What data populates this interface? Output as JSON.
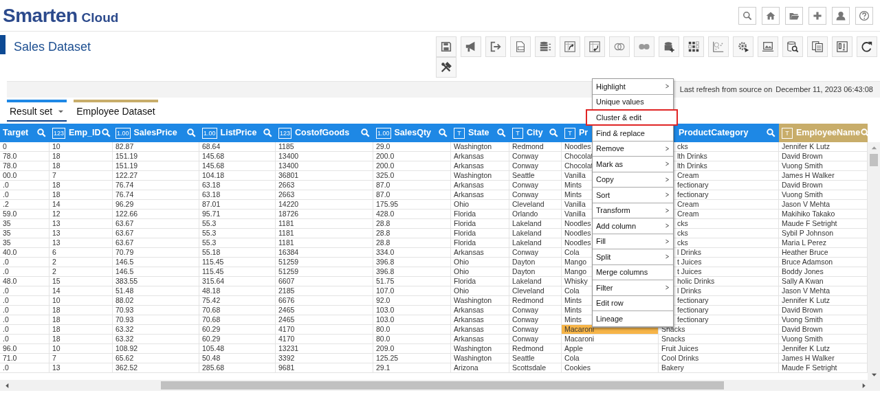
{
  "app": {
    "brand": "Smarten",
    "product": "Cloud"
  },
  "page_title": "Sales Dataset",
  "refresh": {
    "label": "Last refresh from source on",
    "timestamp": "December 11, 2023 06:43:08"
  },
  "tabs": [
    {
      "label": "Result set",
      "selected": true,
      "dropdown": true,
      "color": "#1e88e5"
    },
    {
      "label": "Employee Dataset",
      "selected": false,
      "dropdown": false,
      "color": "#c8ad6a"
    }
  ],
  "table": {
    "columns": [
      {
        "name": "Target",
        "searchable": true,
        "color": "#1e88e5"
      },
      {
        "name": "Emp_ID",
        "type_icon": "123",
        "searchable": true,
        "color": "#1e88e5"
      },
      {
        "name": "SalesPrice",
        "type_icon": "1.00",
        "searchable": true,
        "color": "#1e88e5"
      },
      {
        "name": "ListPrice",
        "type_icon": "1.00",
        "searchable": true,
        "color": "#1e88e5"
      },
      {
        "name": "CostofGoods",
        "type_icon": "123",
        "searchable": true,
        "color": "#1e88e5"
      },
      {
        "name": "SalesQty",
        "type_icon": "1.00",
        "searchable": true,
        "color": "#1e88e5"
      },
      {
        "name": "State",
        "type_icon": "T",
        "searchable": true,
        "color": "#1e88e5"
      },
      {
        "name": "City",
        "type_icon": "T",
        "searchable": true,
        "color": "#1e88e5"
      },
      {
        "name": "Pr",
        "type_icon": "T",
        "color": "#1e88e5"
      },
      {
        "name": "ProductCategory",
        "searchable": true,
        "color": "#1e88e5"
      },
      {
        "name": "EmployeeName",
        "type_icon": "T",
        "searchable": true,
        "color": "#c8ad6a"
      }
    ],
    "rows": [
      {
        "cells": [
          "0",
          "10",
          "82.87",
          "68.64",
          "1185",
          "29.0",
          "Washington",
          "Redmond",
          "Noodles",
          "cks",
          "Jennifer K Lutz"
        ],
        "highlighted": false
      },
      {
        "cells": [
          "78.0",
          "18",
          "151.19",
          "145.68",
          "13400",
          "200.0",
          "Arkansas",
          "Conway",
          "Chocolat",
          "lth Drinks",
          "David Brown"
        ],
        "highlighted": false
      },
      {
        "cells": [
          "78.0",
          "18",
          "151.19",
          "145.68",
          "13400",
          "200.0",
          "Arkansas",
          "Conway",
          "Chocolat",
          "lth Drinks",
          "Vuong Smith"
        ],
        "highlighted": false
      },
      {
        "cells": [
          "00.0",
          "7",
          "122.27",
          "104.18",
          "36801",
          "325.0",
          "Washington",
          "Seattle",
          "Vanilla",
          "Cream",
          "James H Walker"
        ],
        "highlighted": false
      },
      {
        "cells": [
          ".0",
          "18",
          "76.74",
          "63.18",
          "2663",
          "87.0",
          "Arkansas",
          "Conway",
          "Mints",
          "fectionary",
          "David Brown"
        ],
        "highlighted": false
      },
      {
        "cells": [
          ".0",
          "18",
          "76.74",
          "63.18",
          "2663",
          "87.0",
          "Arkansas",
          "Conway",
          "Mints",
          "fectionary",
          "Vuong Smith"
        ],
        "highlighted": false
      },
      {
        "cells": [
          ".2",
          "14",
          "96.29",
          "87.01",
          "14220",
          "175.95",
          "Ohio",
          "Cleveland",
          "Vanilla",
          "Cream",
          "Jason V Mehta"
        ],
        "highlighted": false
      },
      {
        "cells": [
          "59.0",
          "12",
          "122.66",
          "95.71",
          "18726",
          "428.0",
          "Florida",
          "Orlando",
          "Vanilla",
          "Cream",
          "Makihiko Takako"
        ],
        "highlighted": false
      },
      {
        "cells": [
          "35",
          "13",
          "63.67",
          "55.3",
          "1181",
          "28.8",
          "Florida",
          "Lakeland",
          "Noodles",
          "cks",
          "Maude F Setright"
        ],
        "highlighted": false
      },
      {
        "cells": [
          "35",
          "13",
          "63.67",
          "55.3",
          "1181",
          "28.8",
          "Florida",
          "Lakeland",
          "Noodles",
          "cks",
          "Sybil P Johnson"
        ],
        "highlighted": false
      },
      {
        "cells": [
          "35",
          "13",
          "63.67",
          "55.3",
          "1181",
          "28.8",
          "Florida",
          "Lakeland",
          "Noodles",
          "cks",
          "Maria L Perez"
        ],
        "highlighted": false
      },
      {
        "cells": [
          "40.0",
          "6",
          "70.79",
          "55.18",
          "16384",
          "334.0",
          "Arkansas",
          "Conway",
          "Cola",
          "l Drinks",
          "Heather Bruce"
        ],
        "highlighted": false
      },
      {
        "cells": [
          ".0",
          "2",
          "146.5",
          "115.45",
          "51259",
          "396.8",
          "Ohio",
          "Dayton",
          "Mango",
          "t Juices",
          "Bruce Adamson"
        ],
        "highlighted": false
      },
      {
        "cells": [
          ".0",
          "2",
          "146.5",
          "115.45",
          "51259",
          "396.8",
          "Ohio",
          "Dayton",
          "Mango",
          "t Juices",
          "Boddy Jones"
        ],
        "highlighted": false
      },
      {
        "cells": [
          "48.0",
          "15",
          "383.55",
          "315.64",
          "6607",
          "51.75",
          "Florida",
          "Lakeland",
          "Whisky",
          "holic Drinks",
          "Sally A Kwan"
        ],
        "highlighted": false
      },
      {
        "cells": [
          ".0",
          "14",
          "51.48",
          "48.18",
          "2185",
          "107.0",
          "Ohio",
          "Cleveland",
          "Cola",
          "l Drinks",
          "Jason V Mehta"
        ],
        "highlighted": false
      },
      {
        "cells": [
          ".0",
          "10",
          "88.02",
          "75.42",
          "6676",
          "92.0",
          "Washington",
          "Redmond",
          "Mints",
          "fectionary",
          "Jennifer K Lutz"
        ],
        "highlighted": false
      },
      {
        "cells": [
          ".0",
          "18",
          "70.93",
          "70.68",
          "2465",
          "103.0",
          "Arkansas",
          "Conway",
          "Mints",
          "fectionary",
          "David Brown"
        ],
        "highlighted": false
      },
      {
        "cells": [
          ".0",
          "18",
          "70.93",
          "70.68",
          "2465",
          "103.0",
          "Arkansas",
          "Conway",
          "Mints",
          "fectionary",
          "Vuong Smith"
        ],
        "highlighted": false
      },
      {
        "cells": [
          ".0",
          "18",
          "63.32",
          "60.29",
          "4170",
          "80.0",
          "Arkansas",
          "Conway",
          "Macaroni",
          "Snacks",
          "David Brown"
        ],
        "highlighted": true
      },
      {
        "cells": [
          ".0",
          "18",
          "63.32",
          "60.29",
          "4170",
          "80.0",
          "Arkansas",
          "Conway",
          "Macaroni",
          "Snacks",
          "Vuong Smith"
        ],
        "highlighted": false
      },
      {
        "cells": [
          "96.0",
          "10",
          "108.92",
          "105.48",
          "13231",
          "209.0",
          "Washington",
          "Redmond",
          "Apple",
          "Fruit Juices",
          "Jennifer K Lutz"
        ],
        "highlighted": false
      },
      {
        "cells": [
          "71.0",
          "7",
          "65.62",
          "50.48",
          "3392",
          "125.25",
          "Washington",
          "Seattle",
          "Cola",
          "Cool Drinks",
          "James H Walker"
        ],
        "highlighted": false
      },
      {
        "cells": [
          ".0",
          "13",
          "362.52",
          "285.68",
          "9681",
          "29.1",
          "Arizona",
          "Scottsdale",
          "Cookies",
          "Bakery",
          "Maude F Setright"
        ],
        "highlighted": false
      }
    ]
  },
  "context_menu": {
    "items": [
      {
        "label": "Highlight",
        "submenu": true,
        "selected": false
      },
      {
        "label": "Unique values",
        "submenu": false,
        "selected": false
      },
      {
        "label": "Cluster & edit",
        "submenu": false,
        "selected": true
      },
      {
        "label": "Find & replace",
        "submenu": false,
        "selected": false
      },
      {
        "label": "Remove",
        "submenu": true,
        "selected": false
      },
      {
        "label": "Mark as",
        "submenu": true,
        "selected": false
      },
      {
        "label": "Copy",
        "submenu": true,
        "selected": false
      },
      {
        "label": "Sort",
        "submenu": true,
        "selected": false
      },
      {
        "label": "Transform",
        "submenu": true,
        "selected": false
      },
      {
        "label": "Add column",
        "submenu": true,
        "selected": false
      },
      {
        "label": "Fill",
        "submenu": true,
        "selected": false
      },
      {
        "label": "Split",
        "submenu": true,
        "selected": false
      },
      {
        "label": "Merge columns",
        "submenu": false,
        "selected": false
      },
      {
        "label": "Filter",
        "submenu": true,
        "selected": false
      },
      {
        "label": "Edit row",
        "submenu": false,
        "selected": false
      },
      {
        "label": "Lineage",
        "submenu": false,
        "selected": false
      }
    ]
  }
}
